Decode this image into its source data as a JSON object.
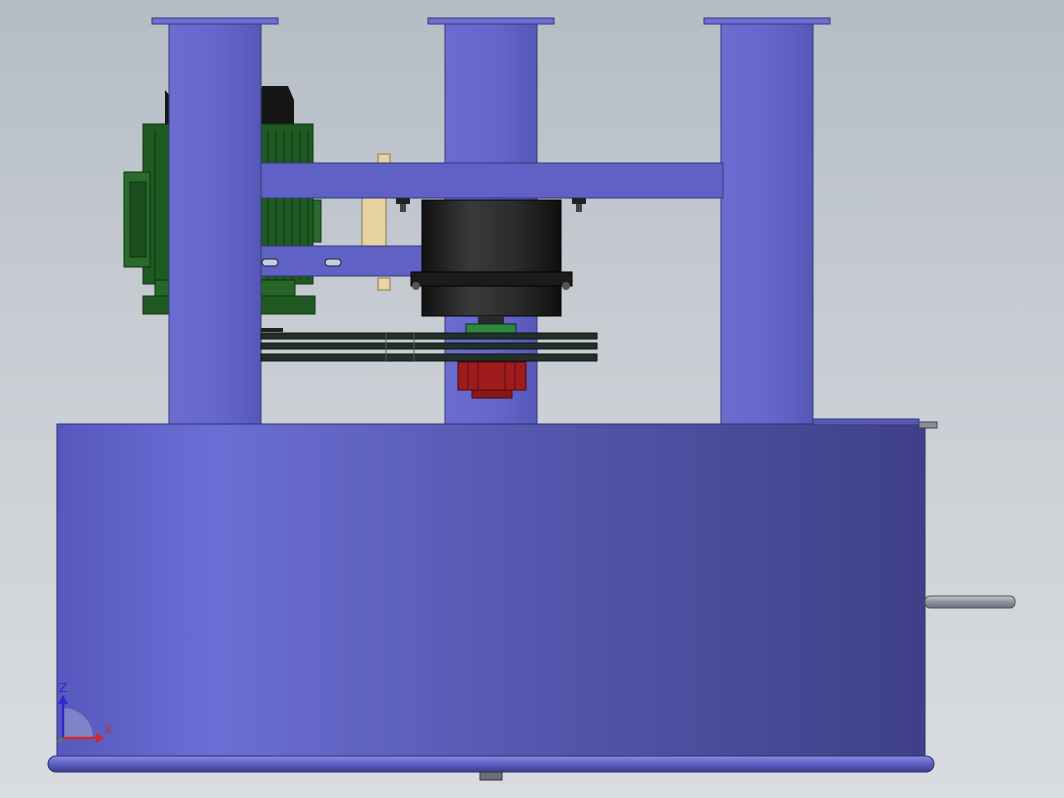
{
  "viewport": {
    "background_top": "#b5bcc4",
    "background_bottom": "#d9dce0"
  },
  "colors": {
    "frame_blue": "#6366c8",
    "frame_blue_dark": "#3d3f86",
    "motor_green": "#1f5a22",
    "motor_black": "#1a1a1a",
    "coupling_red": "#a01c1c",
    "belt_dark": "#23302a",
    "bracket_tan": "#e8d3a2",
    "shaft_grey": "#a0a3b0"
  },
  "triad": {
    "z_label": "Z",
    "x_label": "X",
    "z_color": "#2a2ad0",
    "x_color": "#d02a2a",
    "y_color": "#2aa02a"
  }
}
